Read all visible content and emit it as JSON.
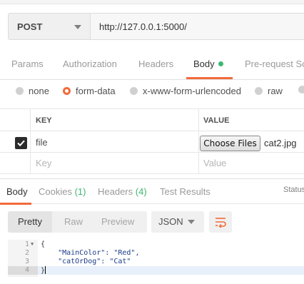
{
  "request": {
    "method": "POST",
    "url": "http://127.0.0.1:5000/"
  },
  "request_tabs": [
    {
      "label": "Params"
    },
    {
      "label": "Authorization"
    },
    {
      "label": "Headers"
    },
    {
      "label": "Body"
    },
    {
      "label": "Pre-request Scr"
    }
  ],
  "body_types": [
    {
      "label": "none",
      "checked": false
    },
    {
      "label": "form-data",
      "checked": true
    },
    {
      "label": "x-www-form-urlencoded",
      "checked": false
    },
    {
      "label": "raw",
      "checked": false
    }
  ],
  "form_table": {
    "key_header": "KEY",
    "value_header": "VALUE",
    "rows": [
      {
        "checked": true,
        "key": "file",
        "button_label": "Choose Files",
        "value": "cat2.jpg"
      }
    ],
    "key_placeholder": "Key",
    "value_placeholder": "Value"
  },
  "response_tabs": [
    {
      "label": "Body"
    },
    {
      "label": "Cookies",
      "count": "(1)"
    },
    {
      "label": "Headers",
      "count": "(4)"
    },
    {
      "label": "Test Results"
    }
  ],
  "status_label": "Status",
  "view_modes": [
    "Pretty",
    "Raw",
    "Preview"
  ],
  "format_select": "JSON",
  "code": {
    "line_numbers": [
      "1",
      "2",
      "3",
      "4"
    ],
    "lines": [
      "{",
      "    \"MainColor\": \"Red\",",
      "    \"catOrDog\": \"Cat\"",
      "}"
    ]
  },
  "colors": {
    "accent": "#f26b3a",
    "success": "#3fb671"
  }
}
